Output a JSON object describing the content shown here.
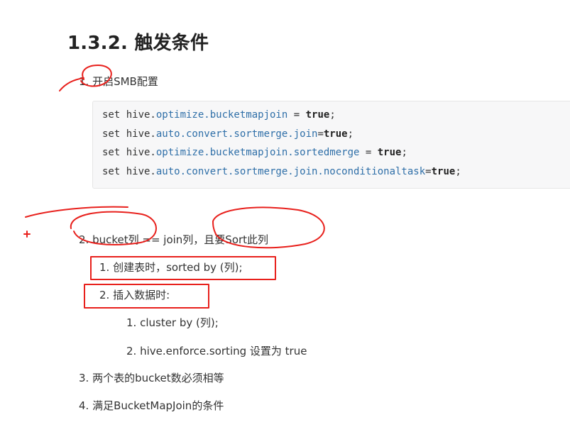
{
  "heading": "1.3.2. 触发条件",
  "item1": "1. 开启SMB配置",
  "code_lines": [
    {
      "kw": "set hive.",
      "prop": "optimize.bucketmapjoin",
      "op": " = ",
      "val": "true",
      "end": ";"
    },
    {
      "kw": "set hive.",
      "prop": "auto.convert.sortmerge.join",
      "op": "=",
      "val": "true",
      "end": ";"
    },
    {
      "kw": "set hive.",
      "prop": "optimize.bucketmapjoin.sortedmerge",
      "op": " = ",
      "val": "true",
      "end": ";"
    },
    {
      "kw": "set hive.",
      "prop": "auto.convert.sortmerge.join.noconditionaltask",
      "op": "=",
      "val": "true",
      "end": ";"
    }
  ],
  "item2": "2. bucket列 == join列，且要Sort此列",
  "item2_1": "1. 创建表时，sorted by (列);",
  "item2_2": "2. 插入数据时:",
  "item2_2_1": "1. cluster by (列);",
  "item2_2_2": "2. hive.enforce.sorting 设置为 true",
  "item3": "3. 两个表的bucket数必须相等",
  "item4": "4. 满足BucketMapJoin的条件",
  "annotation_color": "#e8201c"
}
